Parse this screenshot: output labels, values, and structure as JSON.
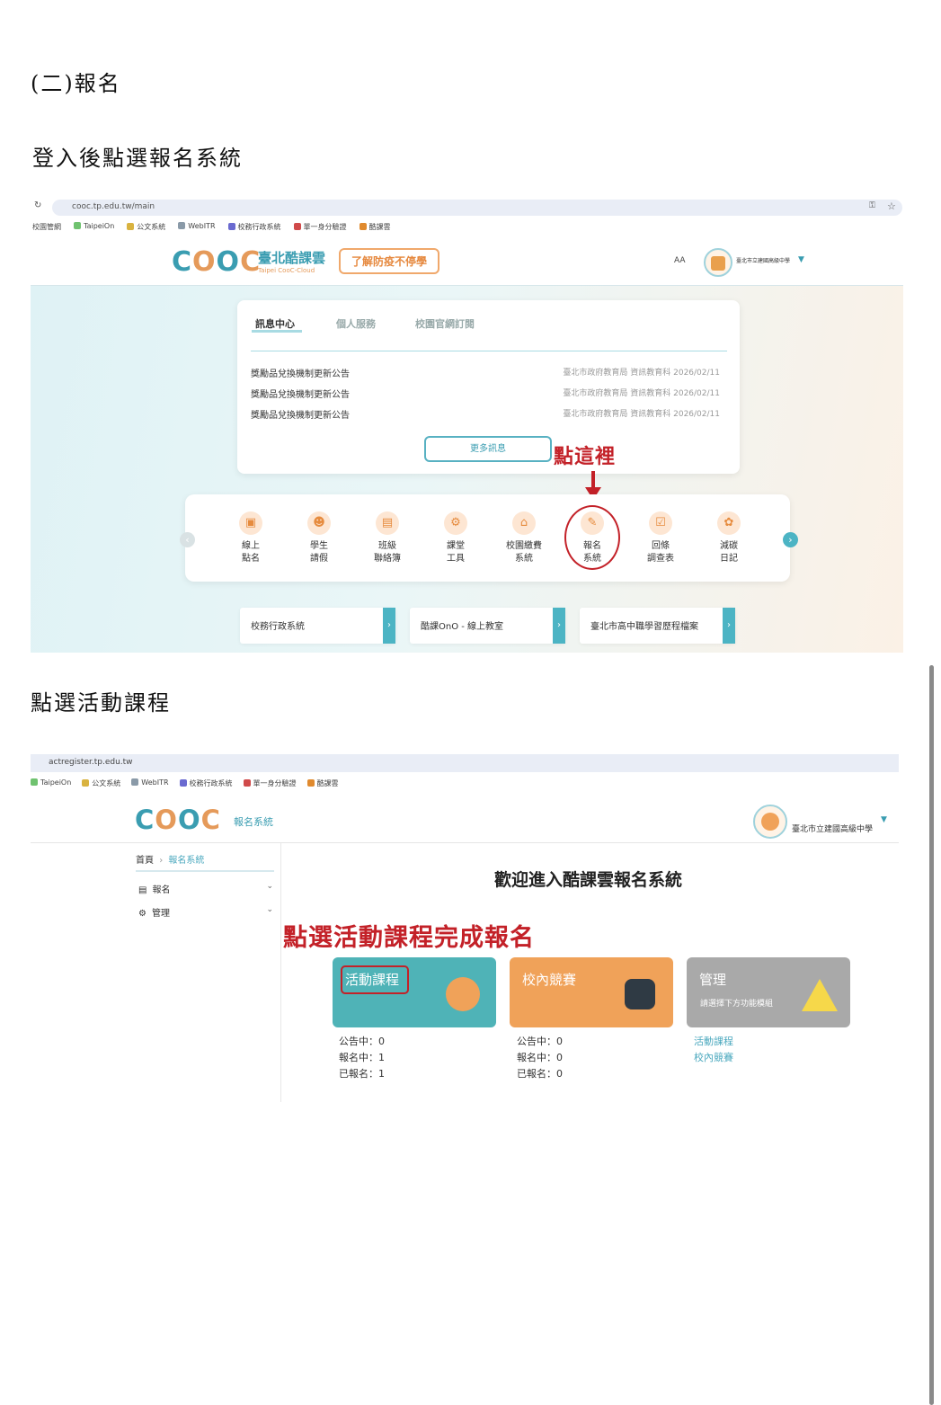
{
  "heading_main": "(二)報名",
  "step1_text": "登入後點選報名系統",
  "step2_text": "點選活動課程",
  "shot1": {
    "url": "cooc.tp.edu.tw/main",
    "bookmarks": [
      "校園管網",
      "TaipeiOn",
      "公文系統",
      "WebITR",
      "校務行政系統",
      "單一身分驗證",
      "酷課雲"
    ],
    "logo_text": "COOC",
    "logo_cn": "臺北酷課雲",
    "logo_en": "Taipei CooC-Cloud",
    "promo_button": "了解防疫不停學",
    "font_size_label": "AA",
    "school_name": "臺北市立建國高級中學",
    "tabs": [
      "訊息中心",
      "個人服務",
      "校園官網訂閱"
    ],
    "news": [
      {
        "title": "獎勵品兌換機制更新公告",
        "meta": "臺北市政府教育局 資訊教育科 2026/02/11"
      },
      {
        "title": "獎勵品兌換機制更新公告",
        "meta": "臺北市政府教育局 資訊教育科 2026/02/11"
      },
      {
        "title": "獎勵品兌換機制更新公告",
        "meta": "臺北市政府教育局 資訊教育科 2026/02/11"
      }
    ],
    "more_button": "更多訊息",
    "annotation": "點這裡",
    "tools": [
      {
        "line1": "線上",
        "line2": "點名",
        "icon": "clipboard-icon"
      },
      {
        "line1": "學生",
        "line2": "請假",
        "icon": "person-icon"
      },
      {
        "line1": "班級",
        "line2": "聯絡簿",
        "icon": "contact-book-icon"
      },
      {
        "line1": "課堂",
        "line2": "工具",
        "icon": "tools-icon"
      },
      {
        "line1": "校園繳費",
        "line2": "系統",
        "icon": "payment-icon"
      },
      {
        "line1": "報名",
        "line2": "系統",
        "icon": "register-icon"
      },
      {
        "line1": "回條",
        "line2": "調查表",
        "icon": "survey-icon"
      },
      {
        "line1": "減碳",
        "line2": "日記",
        "icon": "plant-icon"
      }
    ],
    "systems": [
      "校務行政系統",
      "酷課OnO - 線上教室",
      "臺北市高中職學習歷程檔案"
    ]
  },
  "shot2": {
    "url": "actregister.tp.edu.tw",
    "bookmarks": [
      "TaipeiOn",
      "公文系統",
      "WebITR",
      "校務行政系統",
      "單一身分驗證",
      "酷課雲"
    ],
    "logo_text": "COOC",
    "system_name": "報名系統",
    "school_name": "臺北市立建國高級中學",
    "breadcrumb_home": "首頁",
    "breadcrumb_current": "報名系統",
    "menu": [
      "報名",
      "管理"
    ],
    "welcome": "歡迎進入酷課雲報名系統",
    "annotation": "點選活動課程完成報名",
    "tiles": [
      {
        "title": "活動課程",
        "color": "#4fb3b7",
        "stats": [
          "公告中：0",
          "報名中：1",
          "已報名：1"
        ]
      },
      {
        "title": "校內競賽",
        "color": "#f0a259",
        "stats": [
          "公告中：0",
          "報名中：0",
          "已報名：0"
        ]
      },
      {
        "title": "管理",
        "subtitle": "請選擇下方功能模組",
        "color": "#a9a9a9",
        "links": [
          "活動課程",
          "校內競賽"
        ]
      }
    ]
  },
  "colors": {
    "annotation_red": "#c32128",
    "accent_teal": "#4cb4c4",
    "accent_orange": "#f0a259"
  }
}
